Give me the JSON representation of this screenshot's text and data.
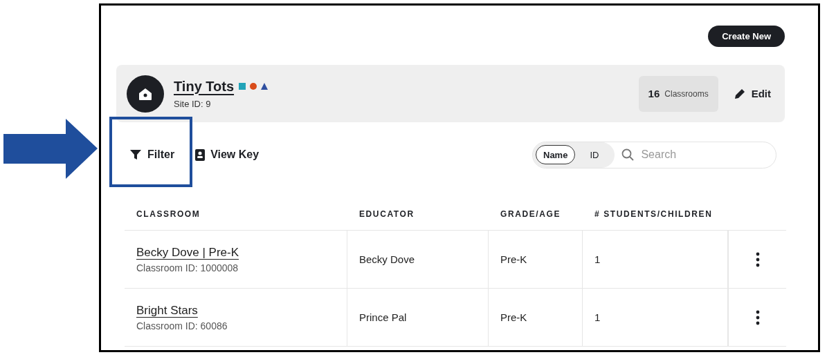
{
  "header": {
    "create_button": "Create New"
  },
  "site": {
    "name": "Tiny Tots",
    "site_id": "Site ID: 9",
    "count": "16",
    "count_label": "Classrooms",
    "edit": "Edit"
  },
  "toolbar": [
    {
      "kind": "filter",
      "label": "Filter",
      "highlighted": true
    },
    {
      "kind": "key",
      "label": "View Key",
      "highlighted": false
    }
  ],
  "search": {
    "modes": [
      {
        "label": "Name",
        "selected": true
      },
      {
        "label": "ID",
        "selected": false
      }
    ],
    "placeholder": "Search"
  },
  "table": {
    "columns": [
      "CLASSROOM",
      "EDUCATOR",
      "GRADE/AGE",
      "# STUDENTS/CHILDREN"
    ],
    "rows": [
      {
        "classroom": "Becky Dove | Pre-K",
        "classroom_id": "Classroom ID: 1000008",
        "educator": "Becky Dove",
        "grade": "Pre-K",
        "students": "1"
      },
      {
        "classroom": "Bright Stars",
        "classroom_id": "Classroom ID: 60086",
        "educator": "Prince Pal",
        "grade": "Pre-K",
        "students": "1"
      }
    ]
  }
}
